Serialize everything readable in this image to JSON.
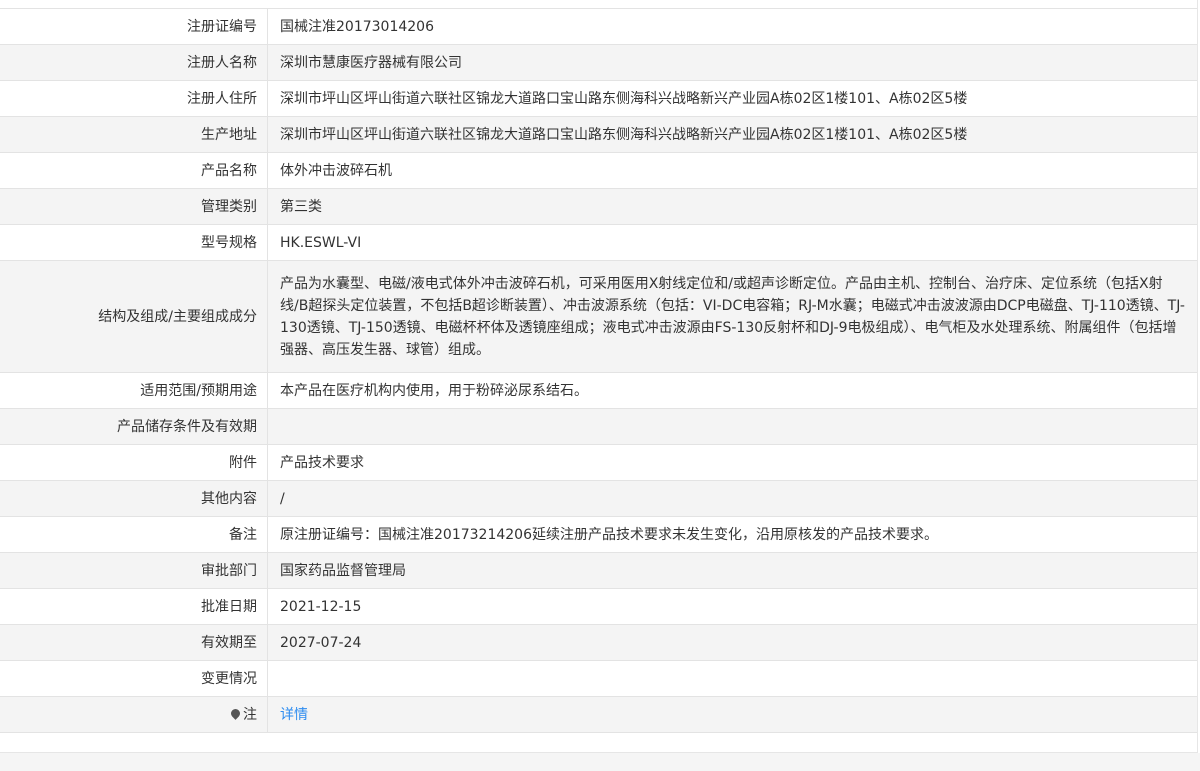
{
  "rows": [
    {
      "label": "注册证编号",
      "value": "国械注准20173014206"
    },
    {
      "label": "注册人名称",
      "value": "深圳市慧康医疗器械有限公司"
    },
    {
      "label": "注册人住所",
      "value": "深圳市坪山区坪山街道六联社区锦龙大道路口宝山路东侧海科兴战略新兴产业园A栋02区1楼101、A栋02区5楼"
    },
    {
      "label": "生产地址",
      "value": "深圳市坪山区坪山街道六联社区锦龙大道路口宝山路东侧海科兴战略新兴产业园A栋02区1楼101、A栋02区5楼"
    },
    {
      "label": "产品名称",
      "value": "体外冲击波碎石机"
    },
    {
      "label": "管理类别",
      "value": "第三类"
    },
    {
      "label": "型号规格",
      "value": "HK.ESWL-VI"
    },
    {
      "label": "结构及组成/主要组成成分",
      "value": "产品为水囊型、电磁/液电式体外冲击波碎石机，可采用医用X射线定位和/或超声诊断定位。产品由主机、控制台、治疗床、定位系统（包括X射线/B超探头定位装置，不包括B超诊断装置）、冲击波源系统（包括：VI-DC电容箱；RJ-M水囊；电磁式冲击波波源由DCP电磁盘、TJ-110透镜、TJ-130透镜、TJ-150透镜、电磁杯杯体及透镜座组成；液电式冲击波源由FS-130反射杯和DJ-9电极组成）、电气柜及水处理系统、附属组件（包括增强器、高压发生器、球管）组成。"
    },
    {
      "label": "适用范围/预期用途",
      "value": "本产品在医疗机构内使用，用于粉碎泌尿系结石。"
    },
    {
      "label": "产品储存条件及有效期",
      "value": ""
    },
    {
      "label": "附件",
      "value": "产品技术要求"
    },
    {
      "label": "其他内容",
      "value": "/"
    },
    {
      "label": "备注",
      "value": "原注册证编号：国械注准20173214206延续注册产品技术要求未发生变化，沿用原核发的产品技术要求。"
    },
    {
      "label": "审批部门",
      "value": "国家药品监督管理局"
    },
    {
      "label": "批准日期",
      "value": "2021-12-15"
    },
    {
      "label": "有效期至",
      "value": "2027-07-24"
    },
    {
      "label": "变更情况",
      "value": ""
    },
    {
      "label": "注",
      "value": "详情"
    }
  ],
  "colors": {
    "link": "#2d8cf0",
    "row_alt": "#f4f4f4",
    "border": "#e3e3e3"
  },
  "icons": {
    "note_label_icon": "map-pin-icon"
  }
}
